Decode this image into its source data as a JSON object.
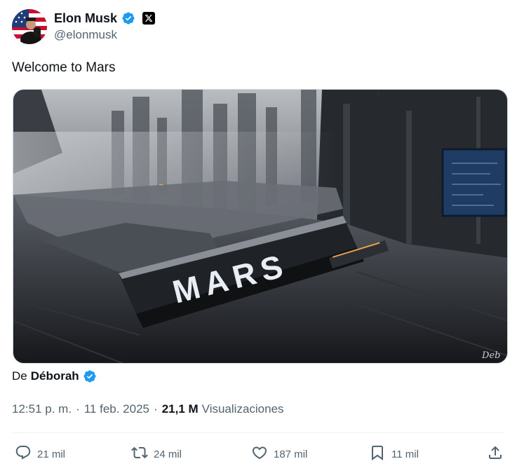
{
  "author": {
    "display_name": "Elon Musk",
    "handle": "@elonmusk",
    "verified_color": "#1d9bf0"
  },
  "tweet": {
    "text": "Welcome to Mars",
    "media_overlay_text": "MARS",
    "media_signature": "Deb"
  },
  "credit": {
    "prefix": "De",
    "name": "Déborah"
  },
  "meta": {
    "time": "12:51 p. m.",
    "separator": "·",
    "date": "11 feb. 2025",
    "views_count": "21,1 M",
    "views_label": "Visualizaciones"
  },
  "actions": {
    "replies": "21 mil",
    "reposts": "24 mil",
    "likes": "187 mil",
    "bookmarks": "11 mil"
  },
  "icons": {
    "reply": "reply-icon",
    "repost": "repost-icon",
    "like": "heart-icon",
    "bookmark": "bookmark-icon",
    "share": "share-icon",
    "verified": "verified-badge-icon",
    "platform": "x-logo-icon"
  }
}
